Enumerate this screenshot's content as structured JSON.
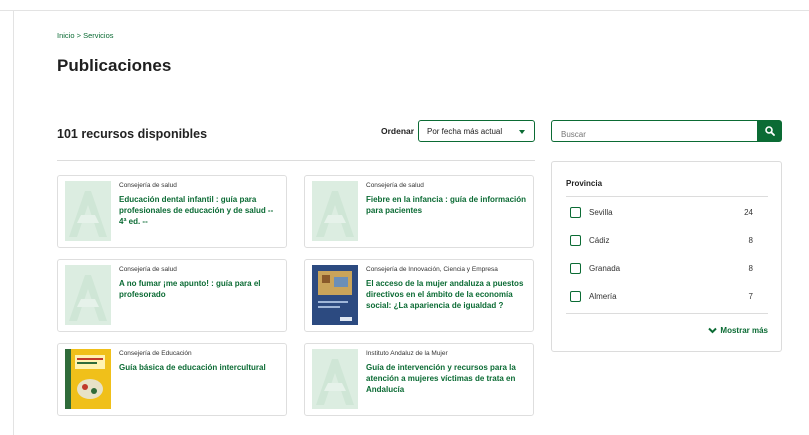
{
  "breadcrumb": {
    "home": "Inicio",
    "separator": ">",
    "current": "Servicios"
  },
  "page_title": "Publicaciones",
  "results": {
    "count_label": "101 recursos disponibles"
  },
  "order": {
    "label": "Ordenar",
    "selected": "Por fecha más actual"
  },
  "search": {
    "placeholder": "Buscar",
    "button_icon": "search-icon"
  },
  "cards": [
    {
      "dept": "Consejería de salud",
      "title": "Educación dental infantil : guía para profesionales de educación y de salud -- 4ª ed. --",
      "thumb": "placeholder-logo"
    },
    {
      "dept": "Consejería de salud",
      "title": "Fiebre en la infancia : guía de información para pacientes",
      "thumb": "placeholder-logo"
    },
    {
      "dept": "Consejería de salud",
      "title": "A no fumar ¡me apunto! : guía para el profesorado",
      "thumb": "placeholder-logo"
    },
    {
      "dept": "Consejería de Innovación, Ciencia y Empresa",
      "title": "El acceso de la mujer andaluza a puestos directivos en el ámbito de la economía social: ¿La apariencia de igualdad ?",
      "thumb": "book-cover-blue"
    },
    {
      "dept": "Consejería de Educación",
      "title": "Guía básica de educación intercultural",
      "thumb": "book-cover-yellow"
    },
    {
      "dept": "Instituto Andaluz de la Mujer",
      "title": "Guía de intervención y recursos para la atención a mujeres víctimas de trata en Andalucía",
      "thumb": "placeholder-logo"
    }
  ],
  "filters": {
    "title": "Provincia",
    "items": [
      {
        "label": "Sevilla",
        "count": "24"
      },
      {
        "label": "Cádiz",
        "count": "8"
      },
      {
        "label": "Granada",
        "count": "8"
      },
      {
        "label": "Almería",
        "count": "7"
      }
    ],
    "show_more": "Mostrar más"
  },
  "colors": {
    "accent": "#0b6b34",
    "placeholder": "#dcede1"
  }
}
